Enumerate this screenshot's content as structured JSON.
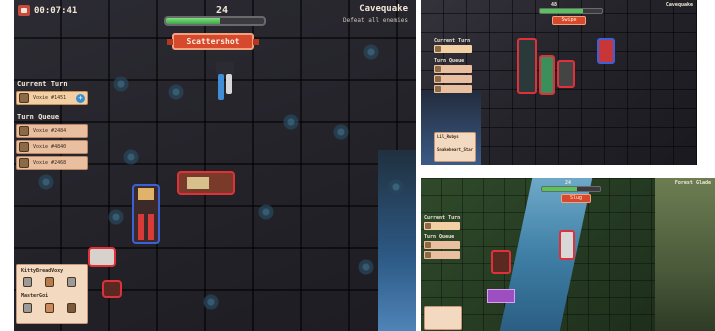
{
  "main": {
    "timer": "00:07:41",
    "hp_value": "24",
    "hp_fraction": 0.55,
    "ability_name": "Scattershot",
    "map_name": "Cavequake",
    "objective": "Defeat all enemies",
    "current_turn_label": "Current Turn",
    "current_turn_unit": "Voxie #1451",
    "turn_queue_label": "Turn Queue",
    "queue": [
      "Voxie #2484",
      "Voxie #4840",
      "Voxie #2468"
    ],
    "roster_title": "KittyBreadVoxy",
    "roster_sub": "MasterGoi",
    "accent": "#d6492d",
    "hp_color": "#56c45a"
  },
  "top_right": {
    "hp_value": "48",
    "hp_fraction": 0.7,
    "ability_name": "Swipe",
    "map_name": "Cavequake",
    "current_turn_label": "Current Turn",
    "turn_queue_label": "Turn Queue",
    "roster_name": "Lil_Rubys",
    "roster_sub": "Snakeheart_Star"
  },
  "bottom_right": {
    "hp_value": "24",
    "hp_fraction": 0.6,
    "ability_name": "Slug",
    "map_name": "Forest Glade",
    "current_turn_label": "Current Turn",
    "turn_queue_label": "Turn Queue"
  }
}
